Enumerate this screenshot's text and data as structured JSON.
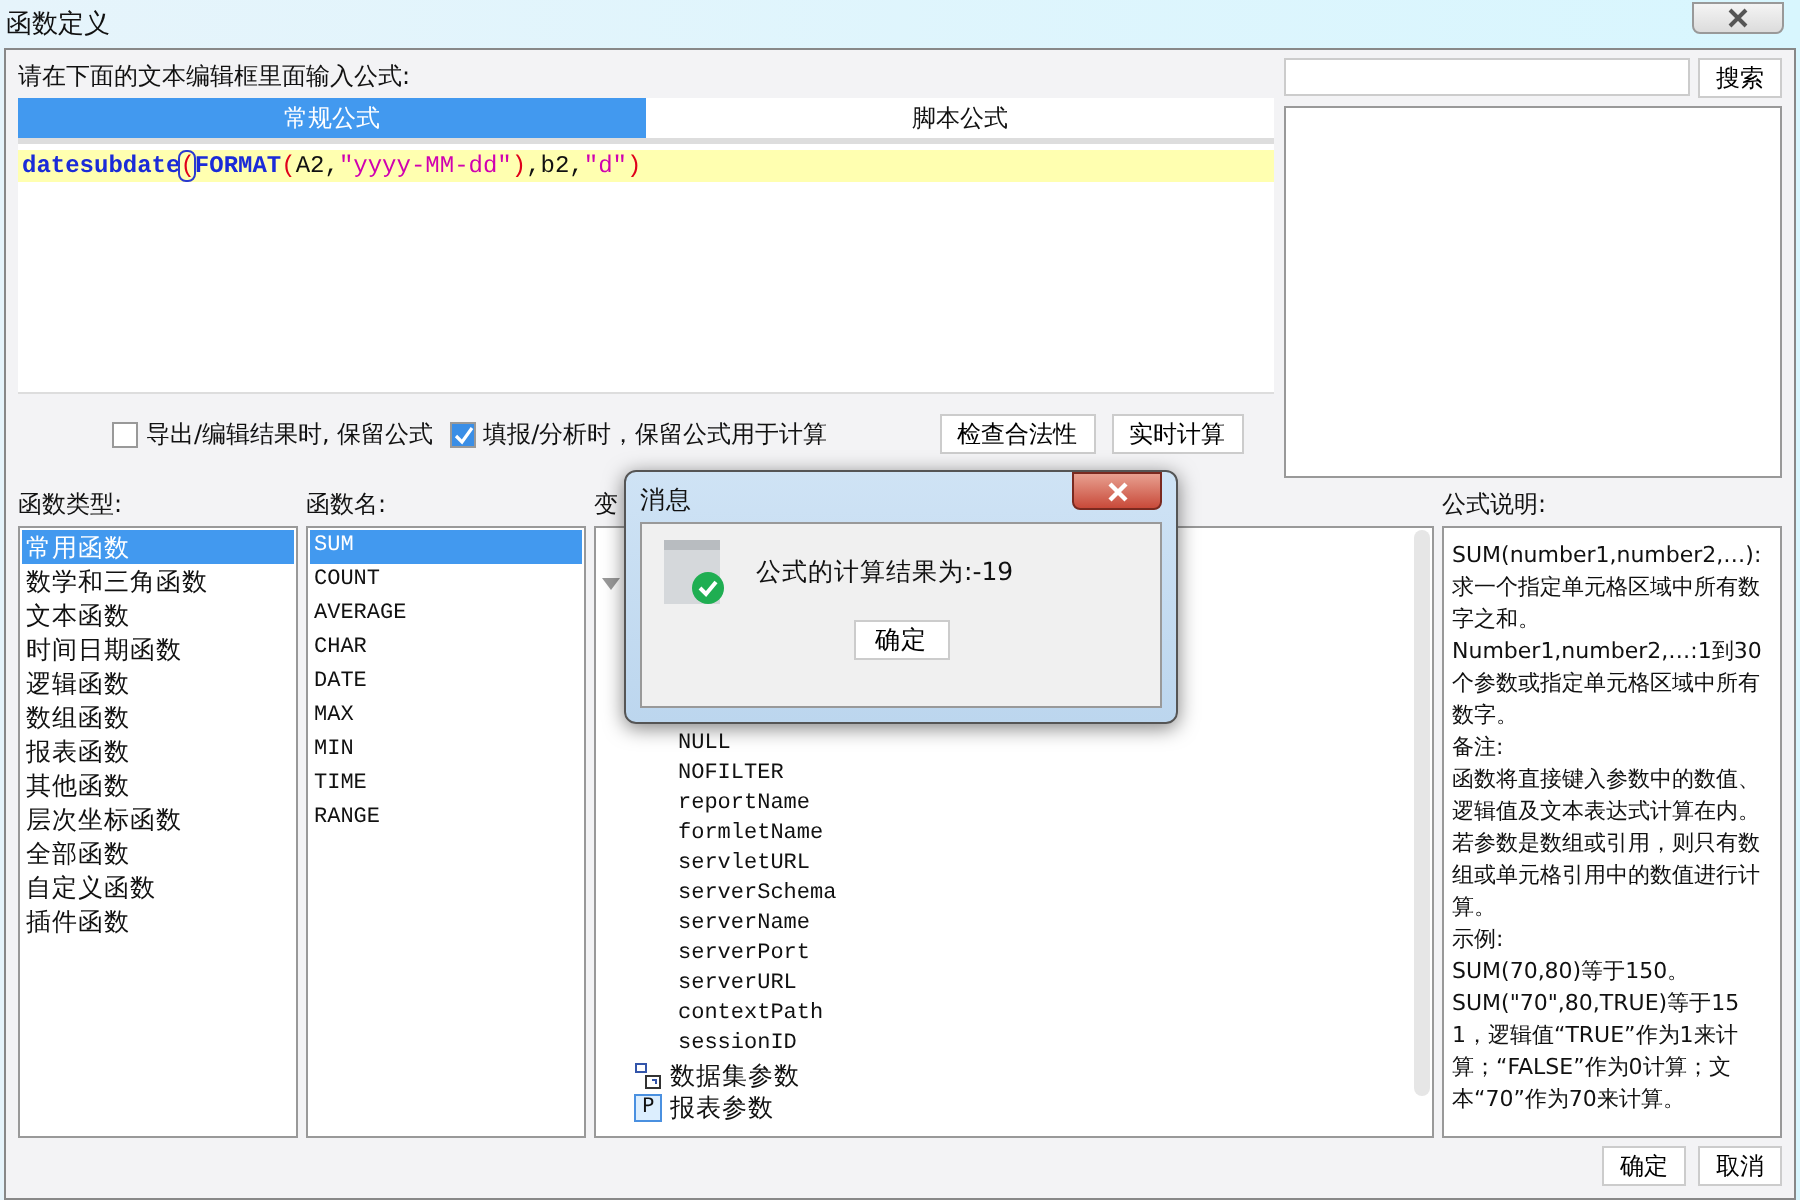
{
  "window": {
    "title": "函数定义"
  },
  "editor": {
    "label": "请在下面的文本编辑框里面输入公式:",
    "tabs": [
      {
        "label": "常规公式",
        "selected": true
      },
      {
        "label": "脚本公式",
        "selected": false
      }
    ],
    "formula": [
      {
        "kind": "func",
        "text": "datesubdate"
      },
      {
        "kind": "paren",
        "text": "(",
        "cursor": true
      },
      {
        "kind": "func",
        "text": "FORMAT"
      },
      {
        "kind": "paren",
        "text": "("
      },
      {
        "kind": "plain",
        "text": "A2,"
      },
      {
        "kind": "string",
        "text": "\"yyyy-MM-dd\""
      },
      {
        "kind": "paren",
        "text": ")"
      },
      {
        "kind": "plain",
        "text": ",b2,"
      },
      {
        "kind": "string",
        "text": "\"d\""
      },
      {
        "kind": "paren",
        "text": ")"
      }
    ]
  },
  "options": [
    {
      "label": "导出/编辑结果时, 保留公式",
      "checked": false
    },
    {
      "label": "填报/分析时，保留公式用于计算",
      "checked": true
    }
  ],
  "action_buttons": [
    "检查合法性",
    "实时计算"
  ],
  "search": {
    "button": "搜索"
  },
  "function_types": {
    "label": "函数类型:",
    "items": [
      {
        "label": "常用函数",
        "selected": true
      },
      {
        "label": "数学和三角函数",
        "selected": false
      },
      {
        "label": "文本函数",
        "selected": false
      },
      {
        "label": "时间日期函数",
        "selected": false
      },
      {
        "label": "逻辑函数",
        "selected": false
      },
      {
        "label": "数组函数",
        "selected": false
      },
      {
        "label": "报表函数",
        "selected": false
      },
      {
        "label": "其他函数",
        "selected": false
      },
      {
        "label": "层次坐标函数",
        "selected": false
      },
      {
        "label": "全部函数",
        "selected": false
      },
      {
        "label": "自定义函数",
        "selected": false
      },
      {
        "label": "插件函数",
        "selected": false
      }
    ]
  },
  "function_names": {
    "label": "函数名:",
    "items": [
      {
        "label": "SUM",
        "selected": true
      },
      {
        "label": "COUNT",
        "selected": false
      },
      {
        "label": "AVERAGE",
        "selected": false
      },
      {
        "label": "CHAR",
        "selected": false
      },
      {
        "label": "DATE",
        "selected": false
      },
      {
        "label": "MAX",
        "selected": false
      },
      {
        "label": "MIN",
        "selected": false
      },
      {
        "label": "TIME",
        "selected": false
      },
      {
        "label": "RANGE",
        "selected": false
      }
    ]
  },
  "variables": {
    "label": "变",
    "tree": [
      {
        "expanded": true,
        "children": [
          {
            "label": "NULL"
          },
          {
            "label": "NOFILTER"
          },
          {
            "label": "reportName"
          },
          {
            "label": "formletName"
          },
          {
            "label": "servletURL"
          },
          {
            "label": "serverSchema"
          },
          {
            "label": "serverName"
          },
          {
            "label": "serverPort"
          },
          {
            "label": "serverURL"
          },
          {
            "label": "contextPath"
          },
          {
            "label": "sessionID"
          }
        ]
      },
      {
        "label": "数据集参数",
        "kind": "dataset"
      },
      {
        "label": "报表参数",
        "kind": "param",
        "icon": "P"
      }
    ]
  },
  "description": {
    "label": "公式说明:",
    "paragraphs": [
      "SUM(number1,number2,…):求一个指定单元格区域中所有数字之和。",
      "Number1,number2,…:1到30个参数或指定单元格区域中所有数字。",
      "备注:",
      "函数将直接键入参数中的数值、逻辑值及文本表达式计算在内。若参数是数组或引用，则只有数组或单元格引用中的数值进行计算。",
      "示例:",
      "SUM(70,80)等于150。",
      "SUM(\"70\",80,TRUE)等于151，逻辑值“TRUE”作为1来计算；“FALSE”作为0计算；文本“70”作为70来计算。"
    ]
  },
  "footer_buttons": [
    "确定",
    "取消"
  ],
  "message": {
    "title": "消息",
    "text": "公式的计算结果为:-19",
    "button": "确定"
  }
}
